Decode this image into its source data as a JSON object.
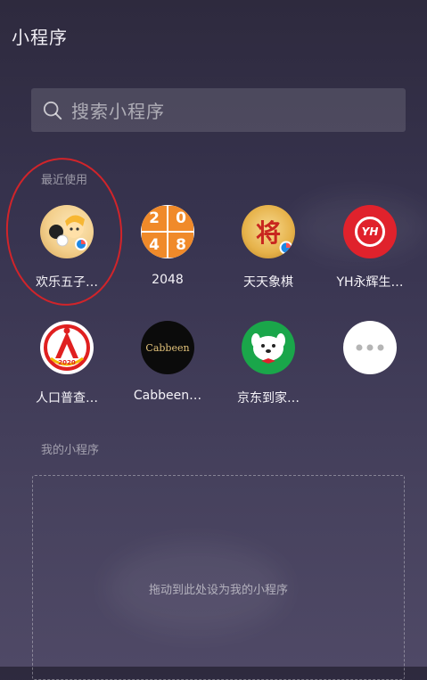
{
  "header": {
    "title": "小程序"
  },
  "search": {
    "placeholder": "搜索小程序"
  },
  "recent": {
    "label": "最近使用",
    "apps": [
      {
        "name": "欢乐五子…",
        "icon": "gomoku-game-icon"
      },
      {
        "name": "2048",
        "icon": "2048-game-icon",
        "tiles": [
          "2",
          "0",
          "4",
          "8"
        ]
      },
      {
        "name": "天天象棋",
        "icon": "chinese-chess-icon",
        "glyph": "将"
      },
      {
        "name": "YH永辉生…",
        "icon": "yh-logo-icon",
        "text": "YH"
      },
      {
        "name": "人口普查…",
        "icon": "census-logo-icon",
        "year": "2020"
      },
      {
        "name": "Cabbeen…",
        "icon": "cabbeen-logo-icon",
        "text": "Cabbeen"
      },
      {
        "name": "京东到家…",
        "icon": "jd-daojia-dog-icon"
      },
      {
        "name": "",
        "icon": "more-icon"
      }
    ]
  },
  "mine": {
    "label": "我的小程序",
    "drop_hint": "拖动到此处设为我的小程序"
  },
  "colors": {
    "accent_red": "#d1242a",
    "orange_2048": "#f08a2a",
    "yh_red": "#e0222c",
    "jd_green": "#1aa64a"
  }
}
